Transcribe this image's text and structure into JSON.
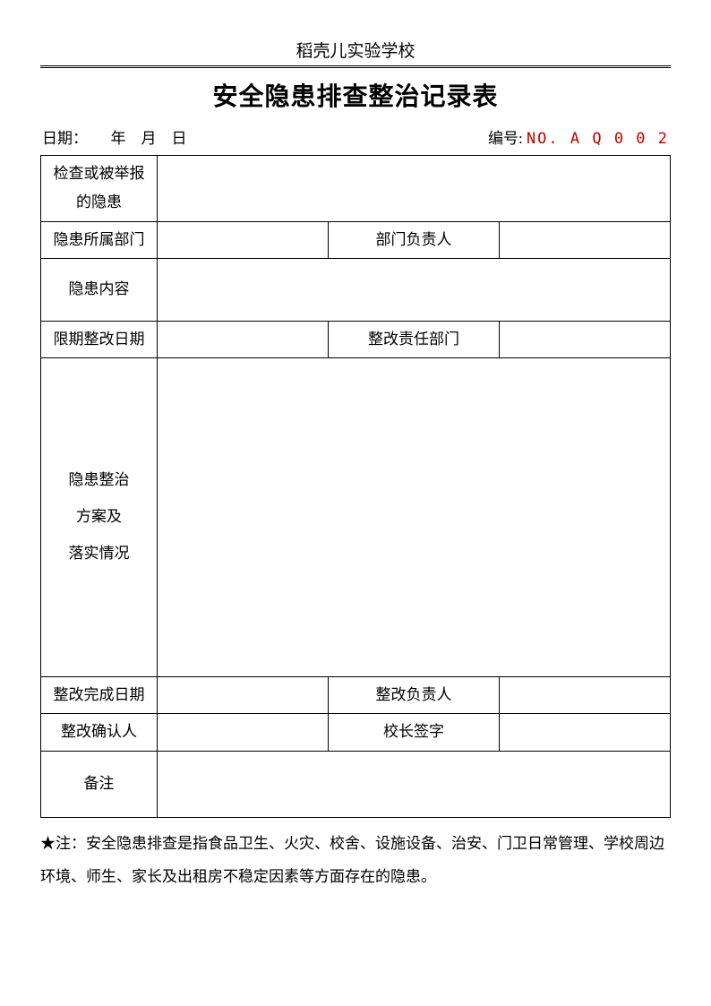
{
  "header": {
    "school": "稻壳儿实验学校",
    "title": "安全隐患排查整治记录表"
  },
  "meta": {
    "date_label": "日期：　　年　月　日",
    "serial_label": "编号:",
    "serial_no": "NO. A Q 0 0 2"
  },
  "rows": {
    "r1_label": "检查或被举报的隐患",
    "r2_label": "隐患所属部门",
    "r2_label2": "部门负责人",
    "r3_label": "隐患内容",
    "r4_label": "限期整改日期",
    "r4_label2": "整改责任部门",
    "r5_label": "隐患整治方案及落实情况",
    "r6_label": "整改完成日期",
    "r6_label2": "整改负责人",
    "r7_label": "整改确认人",
    "r7_label2": "校长签字",
    "r8_label": "备注"
  },
  "footnote": "★注：安全隐患排查是指食品卫生、火灾、校舍、设施设备、治安、门卫日常管理、学校周边环境、师生、家长及出租房不稳定因素等方面存在的隐患。"
}
